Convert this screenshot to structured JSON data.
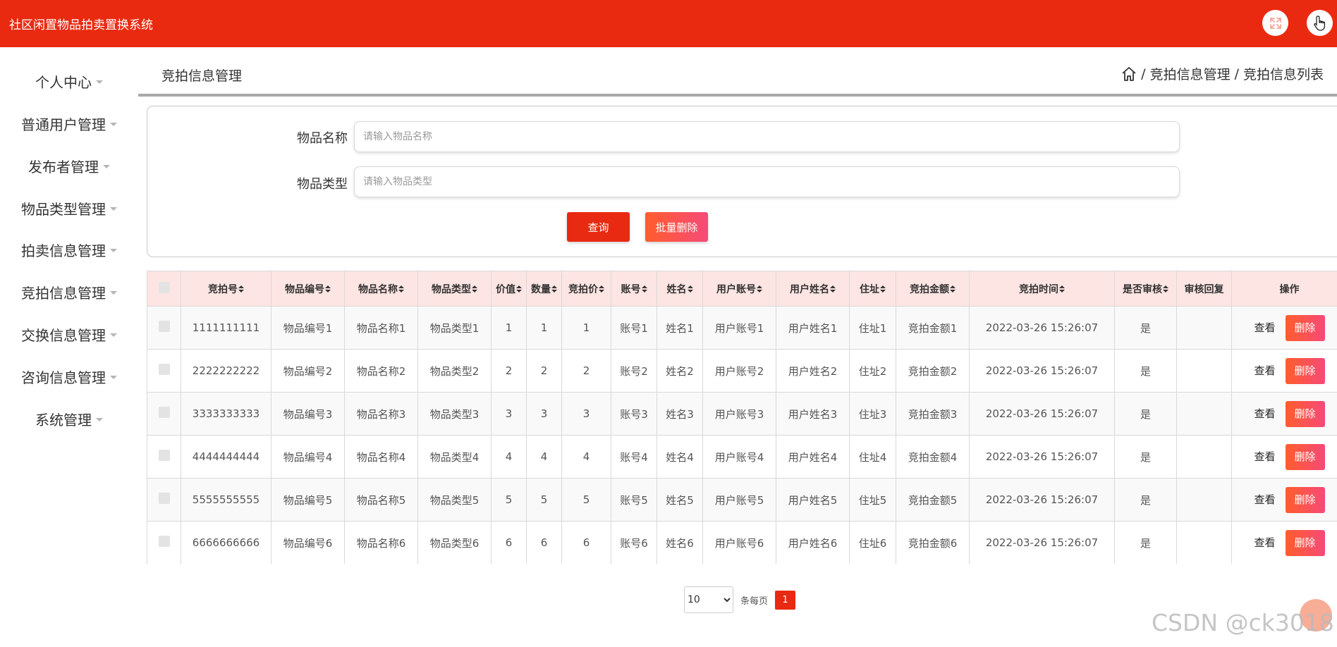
{
  "header": {
    "app_title": "社区闲置物品拍卖置换系统",
    "fullscreen_icon": "fullscreen-icon",
    "user_icon": "hand-pointer-icon"
  },
  "sidebar": {
    "items": [
      {
        "label": "个人中心"
      },
      {
        "label": "普通用户管理"
      },
      {
        "label": "发布者管理"
      },
      {
        "label": "物品类型管理"
      },
      {
        "label": "拍卖信息管理"
      },
      {
        "label": "竞拍信息管理"
      },
      {
        "label": "交换信息管理"
      },
      {
        "label": "咨询信息管理"
      },
      {
        "label": "系统管理"
      }
    ]
  },
  "page": {
    "title": "竞拍信息管理",
    "breadcrumb": [
      "竞拍信息管理",
      "竞拍信息列表"
    ],
    "breadcrumb_sep": "/"
  },
  "search": {
    "name_label": "物品名称",
    "name_placeholder": "请输入物品名称",
    "type_label": "物品类型",
    "type_placeholder": "请输入物品类型",
    "query_button": "查询",
    "batch_delete_button": "批量删除"
  },
  "table": {
    "columns": [
      "竞拍号",
      "物品编号",
      "物品名称",
      "物品类型",
      "价值",
      "数量",
      "竞拍价",
      "账号",
      "姓名",
      "用户账号",
      "用户姓名",
      "住址",
      "竞拍金额",
      "竞拍时间",
      "是否审核",
      "审核回复",
      "操作"
    ],
    "view_label": "查看",
    "delete_label": "删除",
    "rows": [
      [
        "1111111111",
        "物品编号1",
        "物品名称1",
        "物品类型1",
        "1",
        "1",
        "1",
        "账号1",
        "姓名1",
        "用户账号1",
        "用户姓名1",
        "住址1",
        "竞拍金额1",
        "2022-03-26 15:26:07",
        "是",
        ""
      ],
      [
        "2222222222",
        "物品编号2",
        "物品名称2",
        "物品类型2",
        "2",
        "2",
        "2",
        "账号2",
        "姓名2",
        "用户账号2",
        "用户姓名2",
        "住址2",
        "竞拍金额2",
        "2022-03-26 15:26:07",
        "是",
        ""
      ],
      [
        "3333333333",
        "物品编号3",
        "物品名称3",
        "物品类型3",
        "3",
        "3",
        "3",
        "账号3",
        "姓名3",
        "用户账号3",
        "用户姓名3",
        "住址3",
        "竞拍金额3",
        "2022-03-26 15:26:07",
        "是",
        ""
      ],
      [
        "4444444444",
        "物品编号4",
        "物品名称4",
        "物品类型4",
        "4",
        "4",
        "4",
        "账号4",
        "姓名4",
        "用户账号4",
        "用户姓名4",
        "住址4",
        "竞拍金额4",
        "2022-03-26 15:26:07",
        "是",
        ""
      ],
      [
        "5555555555",
        "物品编号5",
        "物品名称5",
        "物品类型5",
        "5",
        "5",
        "5",
        "账号5",
        "姓名5",
        "用户账号5",
        "用户姓名5",
        "住址5",
        "竞拍金额5",
        "2022-03-26 15:26:07",
        "是",
        ""
      ],
      [
        "6666666666",
        "物品编号6",
        "物品名称6",
        "物品类型6",
        "6",
        "6",
        "6",
        "账号6",
        "姓名6",
        "用户账号6",
        "用户姓名6",
        "住址6",
        "竞拍金额6",
        "2022-03-26 15:26:07",
        "是",
        ""
      ]
    ]
  },
  "pagination": {
    "page_size": "10",
    "page_size_options": [
      "10"
    ],
    "per_page_label": "条每页",
    "current_page": "1"
  },
  "watermark": "CSDN @ck3018",
  "colors": {
    "primary": "#ea2a10",
    "header_row_bg": "#fde5e3",
    "delete_gradient_start": "#ff5d2d",
    "delete_gradient_end": "#f64a78"
  }
}
